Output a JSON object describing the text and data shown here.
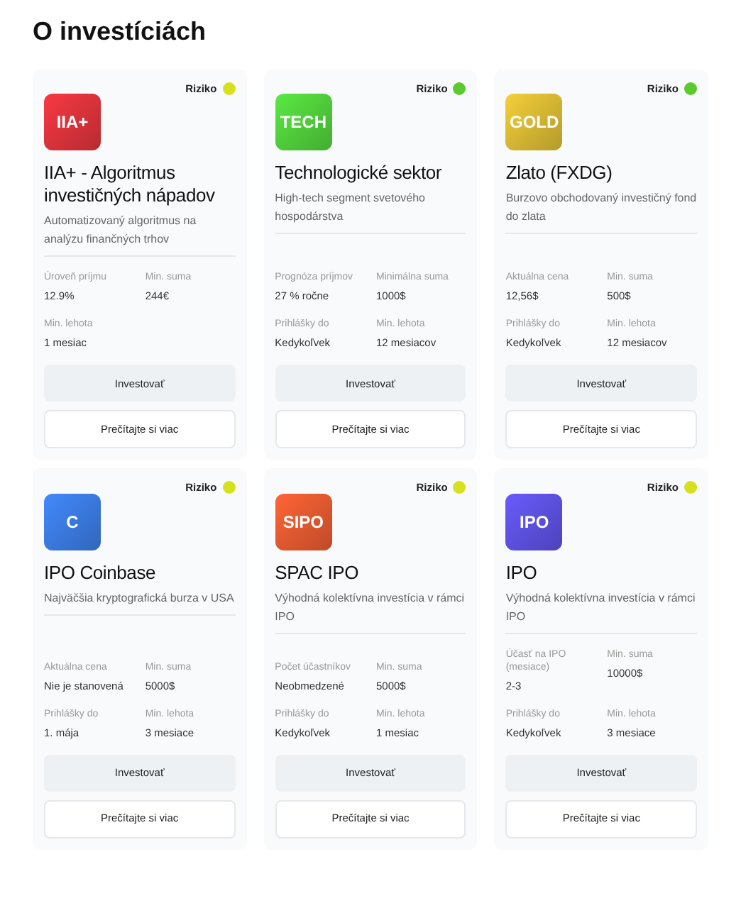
{
  "heading": "O investíciách",
  "cards": [
    {
      "risk": {
        "label": "Riziko",
        "color": "#d6e01c"
      },
      "logo": "IIA+",
      "color": "#d8323a",
      "title": "IIA+ - Algoritmus investičných nápadov",
      "description": "Automatizovaný algoritmus na analýzu finančných trhov",
      "stats": [
        {
          "label": "Úroveň príjmu",
          "value": "12.9%"
        },
        {
          "label": "Min. suma",
          "value": "244€"
        },
        {
          "label": "Min. lehota",
          "value": "1 mesiac"
        }
      ],
      "invest_button": "Investovať",
      "more_button": "Prečítajte si viac"
    },
    {
      "risk": {
        "label": "Riziko",
        "color": "#5cc92c"
      },
      "logo": "TECH",
      "color": "#4fcb3a",
      "title": "Technologické sektor",
      "description": "High-tech segment svetového hospodárstva",
      "stats": [
        {
          "label": "Prognóza príjmov",
          "value": "27 % ročne"
        },
        {
          "label": "Minimálna suma",
          "value": "1000$"
        },
        {
          "label": "Prihlášky do",
          "value": "Kedykoľvek"
        },
        {
          "label": "Min. lehota",
          "value": "12 mesiacov"
        }
      ],
      "invest_button": "Investovať",
      "more_button": "Prečítajte si viac"
    },
    {
      "risk": {
        "label": "Riziko",
        "color": "#5cc92c"
      },
      "logo": "GOLD",
      "color": "#d4b532",
      "title": "Zlato (FXDG)",
      "description": "Burzovo obchodovaný investičný fond do zlata",
      "stats": [
        {
          "label": "Aktuálna cena",
          "value": "12,56$"
        },
        {
          "label": "Min. suma",
          "value": "500$"
        },
        {
          "label": "Prihlášky do",
          "value": "Kedykoľvek"
        },
        {
          "label": "Min. lehota",
          "value": "12 mesiacov"
        }
      ],
      "invest_button": "Investovať",
      "more_button": "Prečítajte si viac"
    },
    {
      "risk": {
        "label": "Riziko",
        "color": "#d6e01c"
      },
      "logo": "C",
      "color": "#3a78dc",
      "title": "IPO Coinbase",
      "description": "Najväčšia kryptografická burza v USA",
      "stats": [
        {
          "label": "Aktuálna cena",
          "value": "Nie je stanovená"
        },
        {
          "label": "Min. suma",
          "value": "5000$"
        },
        {
          "label": "Prihlášky do",
          "value": "1. mája"
        },
        {
          "label": "Min. lehota",
          "value": "3 mesiace"
        }
      ],
      "invest_button": "Investovať",
      "more_button": "Prečítajte si viac"
    },
    {
      "risk": {
        "label": "Riziko",
        "color": "#d6e01c"
      },
      "logo": "SIPO",
      "color": "#e0582f",
      "title": "SPAC IPO",
      "description": "Výhodná kolektívna investícia v rámci IPO",
      "stats": [
        {
          "label": "Počet účastníkov",
          "value": "Neobmedzené"
        },
        {
          "label": "Min. suma",
          "value": "5000$"
        },
        {
          "label": "Prihlášky do",
          "value": "Kedykoľvek"
        },
        {
          "label": "Min. lehota",
          "value": "1 mesiac"
        }
      ],
      "invest_button": "Investovať",
      "more_button": "Prečítajte si viac"
    },
    {
      "risk": {
        "label": "Riziko",
        "color": "#d6e01c"
      },
      "logo": "IPO",
      "color": "#5b4fdc",
      "title": "IPO",
      "description": "Výhodná kolektívna investícia v rámci IPO",
      "stats": [
        {
          "label": "Účasť na IPO (mesiace)",
          "value": "2-3"
        },
        {
          "label": "Min. suma",
          "value": "10000$"
        },
        {
          "label": "Prihlášky do",
          "value": "Kedykoľvek"
        },
        {
          "label": "Min. lehota",
          "value": "3 mesiace"
        }
      ],
      "invest_button": "Investovať",
      "more_button": "Prečítajte si viac"
    }
  ]
}
